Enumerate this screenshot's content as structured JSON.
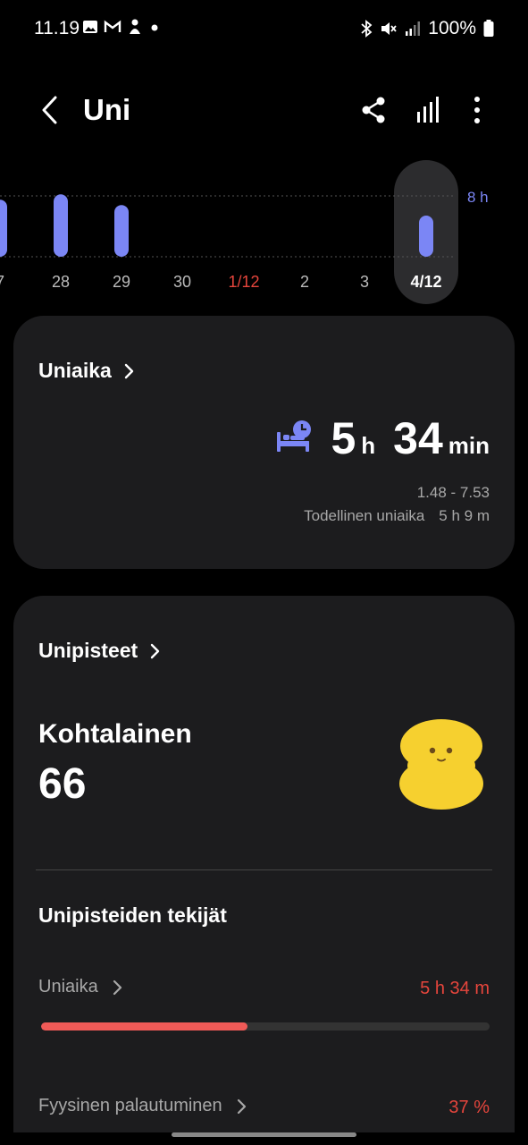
{
  "status_bar": {
    "time": "11.19",
    "battery": "100%",
    "left_icons": [
      "image-icon",
      "gmail-icon",
      "app-icon",
      "dot-icon"
    ],
    "right_icons": [
      "bluetooth-icon",
      "mute-icon",
      "signal-icon",
      "battery-icon"
    ]
  },
  "header": {
    "title": "Uni",
    "icons": [
      "back-icon",
      "share-icon",
      "stats-icon",
      "more-icon"
    ]
  },
  "chart_data": {
    "type": "bar",
    "categories": [
      "7",
      "28",
      "29",
      "30",
      "1/12",
      "2",
      "3",
      "4/12"
    ],
    "highlight_category": "4/12",
    "red_category": "1/12",
    "goal_label": "8 h",
    "values_hours": [
      7.5,
      8.2,
      6.8,
      0,
      0,
      0,
      0,
      5.57
    ],
    "accent_color": "#7b86f5"
  },
  "sleep_time_card": {
    "title": "Uniaika",
    "hours": "5",
    "hours_unit": "h",
    "minutes": "34",
    "minutes_unit": "min",
    "range": "1.48 - 7.53",
    "actual_label": "Todellinen uniaika",
    "actual_value": "5 h 9 m"
  },
  "score_card": {
    "title": "Unipisteet",
    "rating": "Kohtalainen",
    "score": "66",
    "factors_title": "Unipisteiden tekijät",
    "factors": [
      {
        "label": "Uniaika",
        "value": "5 h 34 m",
        "progress": 0.46
      },
      {
        "label": "Fyysinen palautuminen",
        "value": "37 %"
      }
    ]
  }
}
